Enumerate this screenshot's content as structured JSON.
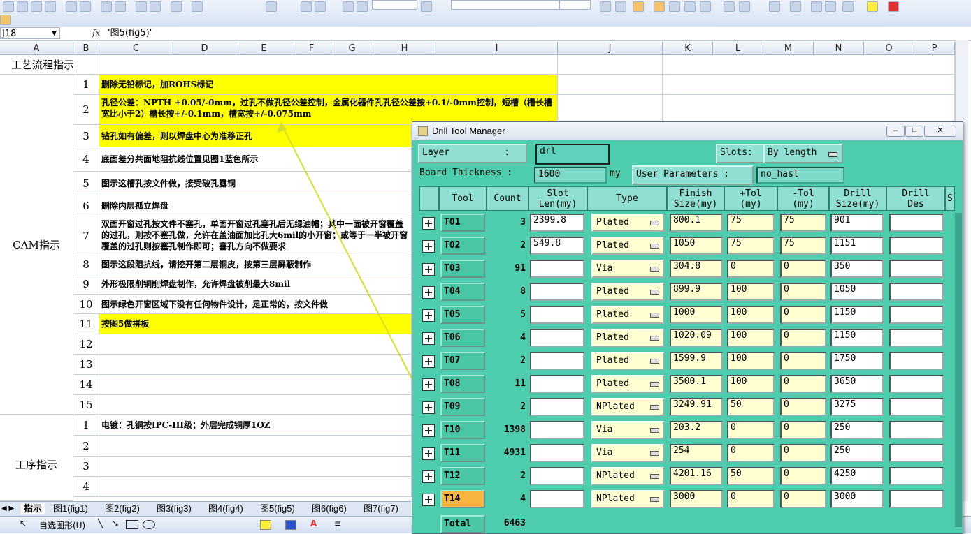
{
  "formula_bar": {
    "cell_ref": "J18",
    "fx": "fx",
    "value": "'图5(fig5)'"
  },
  "columns": [
    "A",
    "B",
    "C",
    "D",
    "E",
    "F",
    "G",
    "H",
    "I",
    "J",
    "K",
    "L",
    "M",
    "N",
    "O",
    "P"
  ],
  "sheet": {
    "title": "工艺流程指示",
    "section_cam": "CAM指示",
    "section_proc": "工序指示",
    "cam_rows": [
      {
        "n": "1",
        "text": "删除无铅标记，加ROHS标记"
      },
      {
        "n": "2",
        "text": "孔径公差：NPTH +0.05/-0mm，过孔不做孔径公差控制，金属化器件孔孔径公差按+0.1/-0mm控制，短槽（槽长槽宽比小于2）槽长按+/-0.1mm，槽宽按+/-0.075mm"
      },
      {
        "n": "3",
        "text": "钻孔如有偏差，则以焊盘中心为准移正孔"
      },
      {
        "n": "4",
        "text": "底面差分共面地阻抗线位置见图1蓝色所示"
      },
      {
        "n": "5",
        "text": "图示这槽孔按文件做，接受破孔露铜"
      },
      {
        "n": "6",
        "text": "删除内层孤立焊盘"
      },
      {
        "n": "7",
        "text": "双面开窗过孔按文件不塞孔，单面开窗过孔塞孔后无绿油帽；其中一面被开窗覆盖的过孔，则按不塞孔做，允许在盖油面加比孔大6mil的小开窗；或等于一半被开窗覆盖的过孔则按塞孔制作即可；塞孔方向不做要求"
      },
      {
        "n": "8",
        "text": "图示这段阻抗线，请挖开第二层铜皮，按第三层屏蔽制作"
      },
      {
        "n": "9",
        "text": "外形极限削铜削焊盘制作，允许焊盘被削最大8mil"
      },
      {
        "n": "10",
        "text": "图示绿色开窗区域下没有任何物件设计，是正常的，按文件做"
      },
      {
        "n": "11",
        "text": "按图5做拼板"
      },
      {
        "n": "12",
        "text": ""
      },
      {
        "n": "13",
        "text": ""
      },
      {
        "n": "14",
        "text": ""
      },
      {
        "n": "15",
        "text": ""
      }
    ],
    "proc_rows": [
      {
        "n": "1",
        "text": "电镀：孔铜按IPC-III级；外层完成铜厚1OZ"
      },
      {
        "n": "2",
        "text": ""
      },
      {
        "n": "3",
        "text": ""
      },
      {
        "n": "4",
        "text": ""
      }
    ],
    "tabs": [
      "指示",
      "图1(fig1)",
      "图2(fig2)",
      "图3(fig3)",
      "图4(fig4)",
      "图5(fig5)",
      "图6(fig6)",
      "图7(fig7)"
    ]
  },
  "drawing_toolbar": {
    "autoshapes": "自选图形(U)"
  },
  "dialog": {
    "title": "Drill Tool Manager",
    "layer_label": "Layer          :",
    "layer_value": "drl",
    "slots_label": "Slots:",
    "slots_value": "By length",
    "board_thickness_label": "Board Thickness :",
    "board_thickness_value": "1600",
    "board_thickness_unit": "my",
    "user_params_label": "User Parameters :",
    "user_params_value": "no_hasl",
    "headers": {
      "tool": "Tool",
      "count": "Count",
      "slot_len": "Slot\nLen(my)",
      "type": "Type",
      "finish": "Finish\nSize(my)",
      "ptol": "+Tol\n(my)",
      "mtol": "-Tol\n(my)",
      "drill": "Drill\nSize(my)",
      "des": "Drill\nDes",
      "s": "S"
    },
    "rows": [
      {
        "tool": "T01",
        "count": "3",
        "slot": "2399.8",
        "type": "Plated",
        "finish": "800.1",
        "ptol": "75",
        "mtol": "75",
        "drill": "901"
      },
      {
        "tool": "T02",
        "count": "2",
        "slot": "549.8",
        "type": "Plated",
        "finish": "1050",
        "ptol": "75",
        "mtol": "75",
        "drill": "1151"
      },
      {
        "tool": "T03",
        "count": "91",
        "slot": "",
        "type": "Via",
        "finish": "304.8",
        "ptol": "0",
        "mtol": "0",
        "drill": "350"
      },
      {
        "tool": "T04",
        "count": "8",
        "slot": "",
        "type": "Plated",
        "finish": "899.9",
        "ptol": "100",
        "mtol": "0",
        "drill": "1050"
      },
      {
        "tool": "T05",
        "count": "5",
        "slot": "",
        "type": "Plated",
        "finish": "1000",
        "ptol": "100",
        "mtol": "0",
        "drill": "1150"
      },
      {
        "tool": "T06",
        "count": "4",
        "slot": "",
        "type": "Plated",
        "finish": "1020.09",
        "ptol": "100",
        "mtol": "0",
        "drill": "1150"
      },
      {
        "tool": "T07",
        "count": "2",
        "slot": "",
        "type": "Plated",
        "finish": "1599.9",
        "ptol": "100",
        "mtol": "0",
        "drill": "1750"
      },
      {
        "tool": "T08",
        "count": "11",
        "slot": "",
        "type": "Plated",
        "finish": "3500.1",
        "ptol": "100",
        "mtol": "0",
        "drill": "3650"
      },
      {
        "tool": "T09",
        "count": "2",
        "slot": "",
        "type": "NPlated",
        "finish": "3249.91",
        "ptol": "50",
        "mtol": "0",
        "drill": "3275"
      },
      {
        "tool": "T10",
        "count": "1398",
        "slot": "",
        "type": "Via",
        "finish": "203.2",
        "ptol": "0",
        "mtol": "0",
        "drill": "250"
      },
      {
        "tool": "T11",
        "count": "4931",
        "slot": "",
        "type": "Via",
        "finish": "254",
        "ptol": "0",
        "mtol": "0",
        "drill": "250"
      },
      {
        "tool": "T12",
        "count": "2",
        "slot": "",
        "type": "NPlated",
        "finish": "4201.16",
        "ptol": "50",
        "mtol": "0",
        "drill": "4250"
      },
      {
        "tool": "T14",
        "count": "4",
        "slot": "",
        "type": "NPlated",
        "finish": "3000",
        "ptol": "0",
        "mtol": "0",
        "drill": "3000"
      }
    ],
    "selected_tool": "T14",
    "total_label": "Total",
    "total_value": "6463"
  },
  "colors": {
    "dialog_bg": "#4ecdae",
    "highlight": "#ffff00",
    "selected_tool": "#f7b53f",
    "arrow": "#d4e02a"
  }
}
